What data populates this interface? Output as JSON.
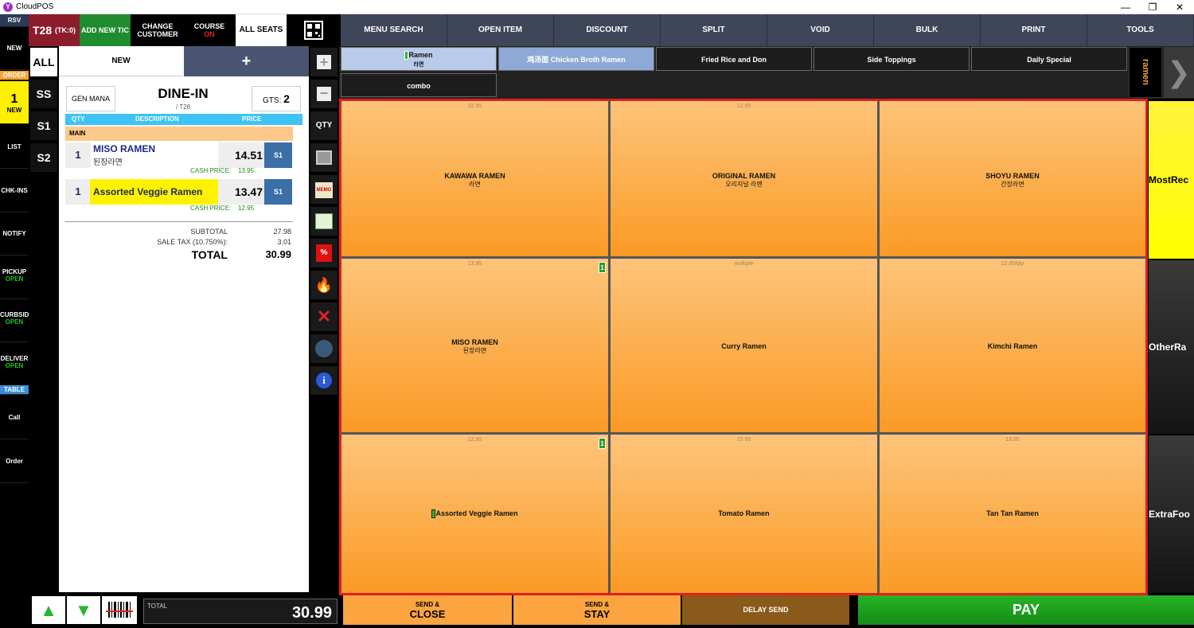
{
  "window": {
    "title": "CloudPOS",
    "controls": [
      "—",
      "❐",
      "✕"
    ]
  },
  "left_nav": {
    "rsv": "RSV",
    "new": "NEW",
    "order": "ORDER",
    "count": "1",
    "count_label": "NEW",
    "list": "LIST",
    "chkins": "CHK-INS",
    "notify": "NOTIFY",
    "pickup": "PICKUP",
    "pickup_status": "OPEN",
    "curbside": "CURBSID",
    "curbside_status": "OPEN",
    "delivery": "DELIVER",
    "delivery_status": "OPEN",
    "table": "TABLE",
    "call": "Call",
    "orderbtn": "Order"
  },
  "ticket": {
    "table": "T28",
    "tk": "(TK:0)",
    "add_new": "ADD NEW TIC",
    "change_customer": "CHANGE CUSTOMER",
    "course": "COURSE",
    "course_status": "ON",
    "all_seats": "ALL SEATS"
  },
  "seats": [
    "ALL",
    "SS",
    "S1",
    "S2"
  ],
  "tabs": {
    "new": "NEW",
    "plus": "+"
  },
  "order_header": {
    "gen_mana": "GEN MANA",
    "type": "DINE-IN",
    "table": "/ T28",
    "gts_label": "GTS:",
    "gts": "2"
  },
  "columns": {
    "qty": "QTY",
    "description": "DESCRIPTION",
    "price": "PRICE"
  },
  "section": "MAIN",
  "items": [
    {
      "qty": "1",
      "name": "MISO RAMEN",
      "sub": "된장라면",
      "price": "14.51",
      "seat": "S1",
      "cash_label": "CASH PRICE:",
      "cash": "13.95"
    },
    {
      "qty": "1",
      "name": "Assorted Veggie Ramen",
      "sub": "",
      "price": "13.47",
      "seat": "S1",
      "cash_label": "CASH PRICE:",
      "cash": "12.95"
    }
  ],
  "totals": {
    "subtotal_label": "SUBTOTAL",
    "subtotal": "27.98",
    "tax_label": "SALE TAX (10.750%):",
    "tax": "3.01",
    "total_label": "TOTAL",
    "total": "30.99"
  },
  "bottom_total": {
    "label": "TOTAL",
    "value": "30.99"
  },
  "toolbar": {
    "qty": "QTY"
  },
  "top_menu": [
    "MENU SEARCH",
    "OPEN ITEM",
    "DISCOUNT",
    "SPLIT",
    "VOID",
    "BULK",
    "PRINT",
    "TOOLS"
  ],
  "categories": [
    {
      "label": "Ramen",
      "sub": "라면"
    },
    {
      "label": "鸡汤面 Chicken Broth Ramen"
    },
    {
      "label": "Fried Rice and Don"
    },
    {
      "label": "Side Toppings"
    },
    {
      "label": "Daily Special"
    },
    {
      "label": "combo"
    }
  ],
  "group_tab": "ramen",
  "menu_items": [
    {
      "price": "15.95",
      "name": "KAWAWA RAMEN",
      "ko": "라면"
    },
    {
      "price": "12.95",
      "name": "ORIGINAL RAMEN",
      "ko": "오리지널 라멘"
    },
    {
      "price": "",
      "name": "SHOYU RAMEN",
      "ko": "간장라면"
    },
    {
      "price": "13.95",
      "name": "MISO RAMEN",
      "ko": "된장라면",
      "badge": "1"
    },
    {
      "price": "multiple",
      "name": "Curry Ramen",
      "ko": ""
    },
    {
      "price": "12.95/qty",
      "name": "Kimchi Ramen",
      "ko": ""
    },
    {
      "price": "12.95",
      "name": "Assorted Veggie Ramen",
      "ko": "",
      "badge": "1"
    },
    {
      "price": "15.95",
      "name": "Tomato Ramen",
      "ko": ""
    },
    {
      "price": "13.95",
      "name": "Tan Tan Ramen",
      "ko": ""
    }
  ],
  "right_groups": [
    "MostRec",
    "OtherRa",
    "ExtraFoo"
  ],
  "bottom": {
    "send_close_top": "SEND &",
    "send_close": "CLOSE",
    "send_stay_top": "SEND &",
    "send_stay": "STAY",
    "delay": "DELAY SEND",
    "pay": "PAY"
  }
}
